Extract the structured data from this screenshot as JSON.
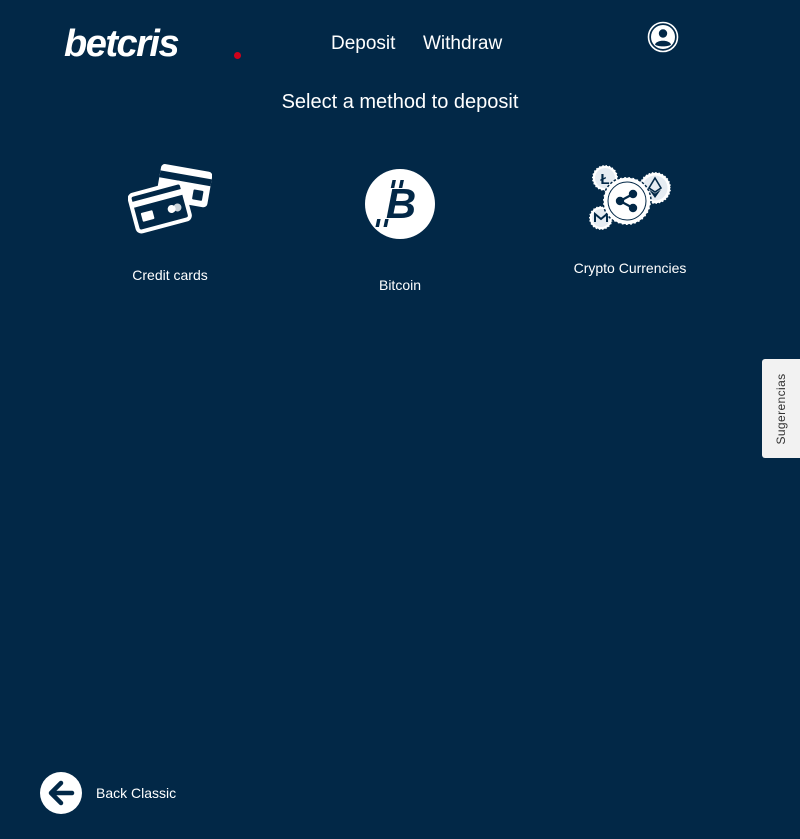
{
  "brand": {
    "logo_text": "betcris",
    "accent_color": "#d0021b",
    "background_color": "#022847"
  },
  "nav": {
    "deposit": "Deposit",
    "withdraw": "Withdraw",
    "user_icon": "user-icon"
  },
  "heading": "Select a method to deposit",
  "methods": [
    {
      "label": "Credit cards",
      "icon": "credit-card-icon"
    },
    {
      "label": "Bitcoin",
      "icon": "bitcoin-icon"
    },
    {
      "label": "Crypto Currencies",
      "icon": "crypto-coins-icon"
    }
  ],
  "feedback_tab": "Sugerencias",
  "back": {
    "label": "Back Classic",
    "icon": "arrow-left-icon"
  }
}
